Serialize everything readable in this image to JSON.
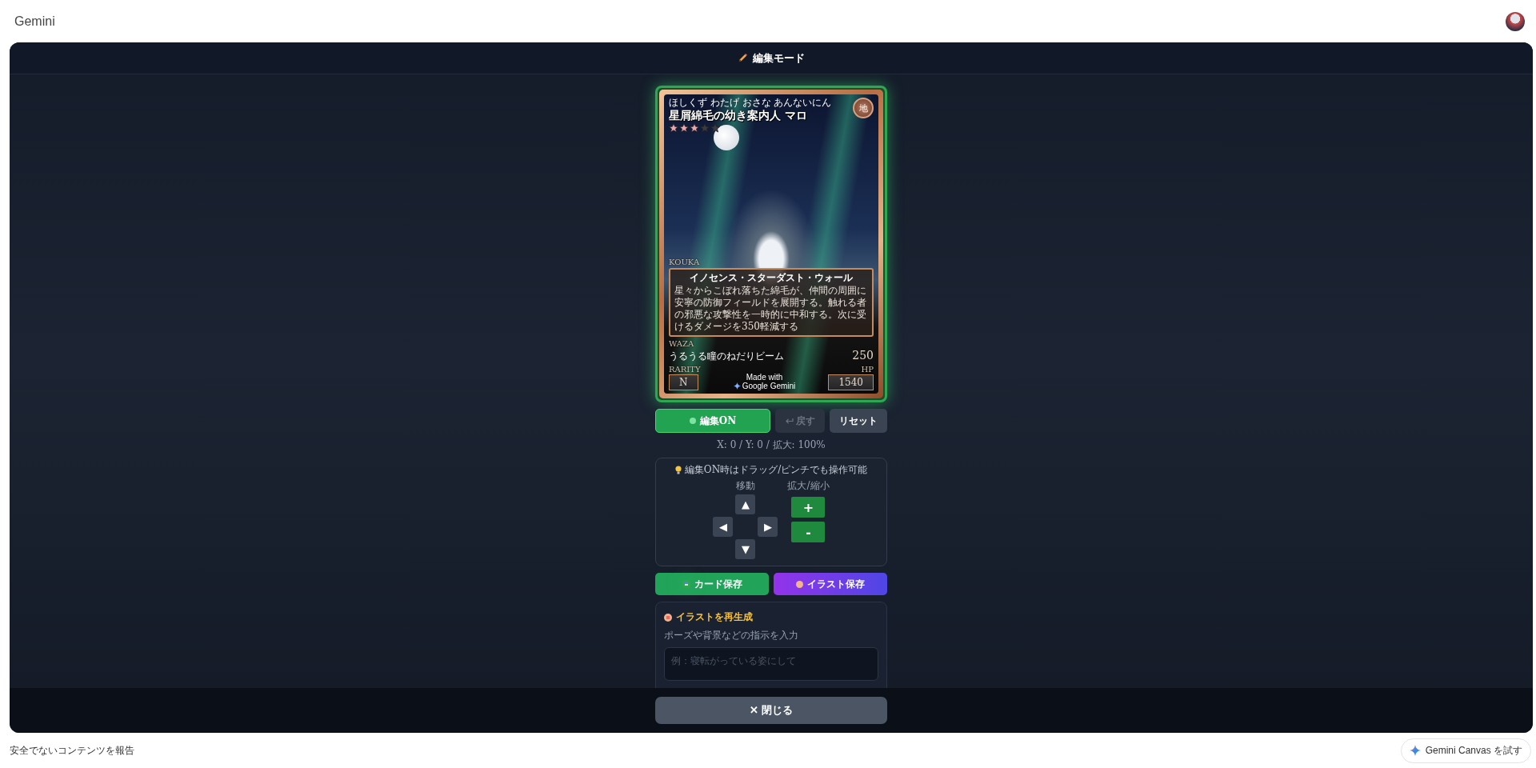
{
  "topbar": {
    "title": "Gemini"
  },
  "header": {
    "title": "編集モード"
  },
  "card": {
    "ruby": "ほしくず わたげ おさな あんないにん",
    "name": "星屑綿毛の幼き案内人 マロ",
    "stars": 3,
    "element": "地",
    "effect_label": "KOUKA",
    "effect_title": "イノセンス・スターダスト・ウォール",
    "effect_text": "星々からこぼれ落ちた綿毛が、仲間の周囲に安寧の防御フィールドを展開する。触れる者の邪悪な攻撃性を一時的に中和する。次に受けるダメージを350軽減する",
    "waza_label": "WAZA",
    "waza_name": "うるうる瞳のねだりビーム",
    "waza_power": "250",
    "rarity_label": "RARITY",
    "rarity": "N",
    "hp_label": "HP",
    "hp": "1540",
    "badge_small": "Made with",
    "badge_brand": "Google Gemini"
  },
  "edit_controls": {
    "toggle": {
      "label": "編集ON",
      "on": true
    },
    "undo": {
      "label": "戻す",
      "disabled": true
    },
    "reset": {
      "label": "リセット"
    }
  },
  "status": "X: 0 / Y: 0 / 拡大: 100%",
  "pad": {
    "hint": "編集ON時はドラッグ/ピンチでも操作可能",
    "move_label": "移動",
    "zoom_label": "拡大/縮小",
    "arrows": [
      "▲",
      "◀",
      "▶",
      "▼"
    ],
    "zoom_in": "+",
    "zoom_out": "-"
  },
  "save_buttons": [
    {
      "label": "カード保存",
      "kind": "card"
    },
    {
      "label": "イラスト保存",
      "kind": "illust"
    }
  ],
  "regenerate": {
    "title": "イラストを再生成",
    "label": "ポーズや背景などの指示を入力",
    "placeholder": "例：寝転がっている姿にして"
  },
  "close_button": "✕ 閉じる",
  "footer": {
    "report_link": "安全でないコンテンツを報告",
    "canvas_button": "Gemini Canvas を試す"
  }
}
